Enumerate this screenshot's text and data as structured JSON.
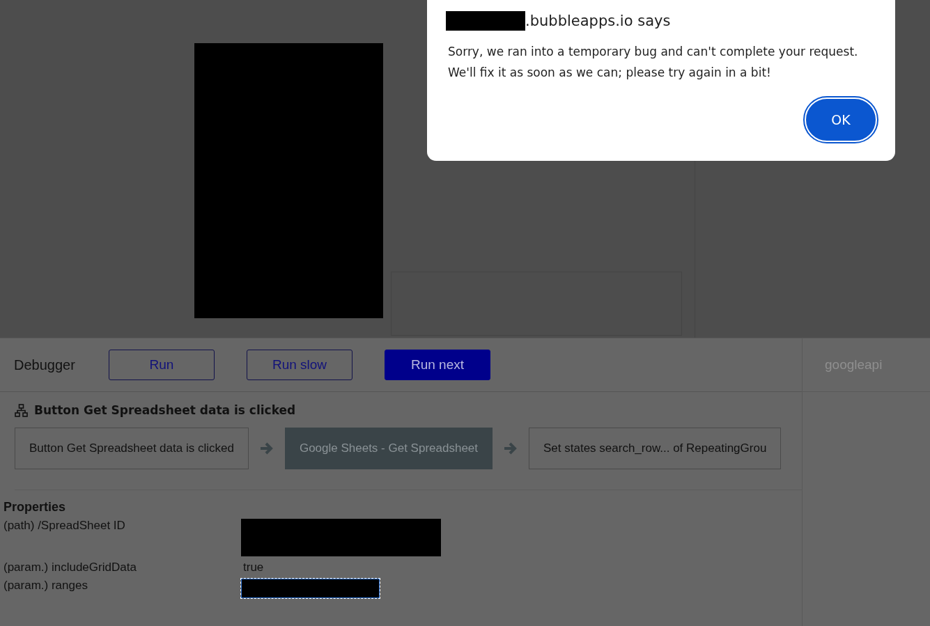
{
  "debugger": {
    "title": "Debugger",
    "buttons": [
      {
        "label": "Run",
        "kind": "outline"
      },
      {
        "label": "Run slow",
        "kind": "outline"
      },
      {
        "label": "Run next",
        "kind": "filled"
      }
    ],
    "side_label": "googleapi",
    "event": {
      "title": "Button Get Spreadsheet data is clicked",
      "steps": [
        {
          "label": "Button Get Spreadsheet data is clicked",
          "selected": false
        },
        {
          "label": "Google Sheets - Get Spreadsheet",
          "selected": true
        },
        {
          "label": "Set states search_row... of RepeatingGrou",
          "selected": false
        }
      ]
    },
    "properties": {
      "title": "Properties",
      "rows": [
        {
          "name": "(path) /SpreadSheet ID",
          "kind": "redacted"
        },
        {
          "name": "(param.) includeGridData",
          "kind": "text",
          "value": "true"
        },
        {
          "name": "(param.) ranges",
          "kind": "redacted-selected"
        }
      ]
    }
  },
  "dialog": {
    "title": ".bubbleapps.io says",
    "message": [
      "Sorry, we ran into a temporary bug and can't complete your request.",
      "We'll fix it as soon as we can; please try again in a bit!"
    ],
    "button": "OK"
  }
}
